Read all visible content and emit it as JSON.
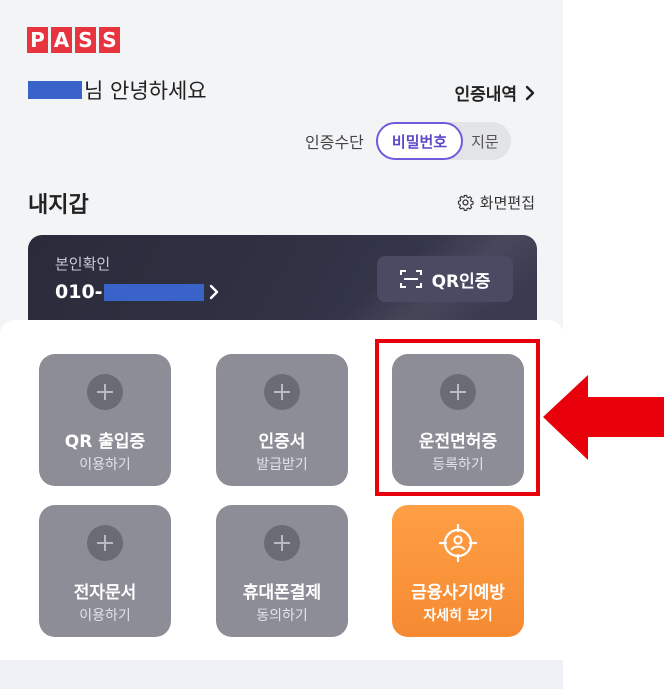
{
  "header": {
    "logo_letters": [
      "P",
      "A",
      "S",
      "S"
    ],
    "greeting_text": "님 안녕하세요",
    "history_label": "인증내역",
    "history_chevron_icon": "chevron-right-icon"
  },
  "auth_method": {
    "label": "인증수단",
    "options": [
      "비밀번호",
      "지문"
    ],
    "selected": "비밀번호"
  },
  "wallet": {
    "title": "내지갑",
    "edit_label": "화면편집",
    "edit_icon": "gear-icon"
  },
  "id_card": {
    "label": "본인확인",
    "phone_prefix": "010-",
    "qr_button_label": "QR인증",
    "qr_icon": "qr-scan-icon"
  },
  "tiles": [
    {
      "title": "QR 출입증",
      "subtitle": "이용하기",
      "icon": "plus-icon"
    },
    {
      "title": "인증서",
      "subtitle": "발급받기",
      "icon": "plus-icon"
    },
    {
      "title": "운전면허증",
      "subtitle": "등록하기",
      "icon": "plus-icon"
    },
    {
      "title": "전자문서",
      "subtitle": "이용하기",
      "icon": "plus-icon"
    },
    {
      "title": "휴대폰결제",
      "subtitle": "동의하기",
      "icon": "plus-icon"
    },
    {
      "title": "금융사기예방",
      "subtitle": "자세히 보기",
      "icon": "target-person-icon"
    }
  ],
  "annotation": {
    "highlight_color": "#e8000b",
    "arrow_color": "#e8000b"
  },
  "colors": {
    "brand_red": "#e8343f",
    "accent_purple": "#6f5bdc",
    "tile_gray": "#8c8d97",
    "tile_orange": "#f58a32",
    "card_dark": "#2f3042"
  }
}
